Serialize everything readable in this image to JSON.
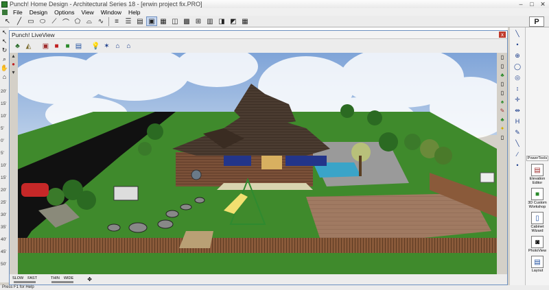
{
  "window": {
    "title": "Punch! Home Design - Architectural Series 18 - [erwin project fix.PRO]"
  },
  "menu": [
    "File",
    "Design",
    "Options",
    "View",
    "Window",
    "Help"
  ],
  "logo_text": "P",
  "liveview": {
    "title": "Punch! LiveView",
    "close_glyph": "x",
    "bottom": {
      "slow": "SLOW",
      "fast": "FAST",
      "thin": "THIN",
      "wide": "WIDE"
    }
  },
  "ruler_labels": [
    "20'",
    "15'",
    "10'",
    "5'",
    "0'",
    "5'",
    "10'",
    "15'",
    "20'",
    "25'",
    "30'",
    "35'",
    "40'",
    "45'",
    "50'"
  ],
  "powertools": {
    "header": "PowerTools",
    "items": [
      {
        "label": "Elevation Editor",
        "icon": "elevation-icon"
      },
      {
        "label": "3D Custom Workshop",
        "icon": "workshop-icon"
      },
      {
        "label": "Cabinet Wizard",
        "icon": "cabinet-icon"
      },
      {
        "label": "PhotoView",
        "icon": "camera-icon"
      },
      {
        "label": "Layout",
        "icon": "layout-icon"
      }
    ]
  },
  "status": {
    "text": "Press F1 for Help"
  },
  "colors": {
    "sky": "#8fb4e4",
    "grass": "#3f8a2c",
    "roof": "#4a3b30",
    "wall": "#7a5038",
    "deck": "#9f7a62",
    "accent": "#6b8fbf"
  }
}
